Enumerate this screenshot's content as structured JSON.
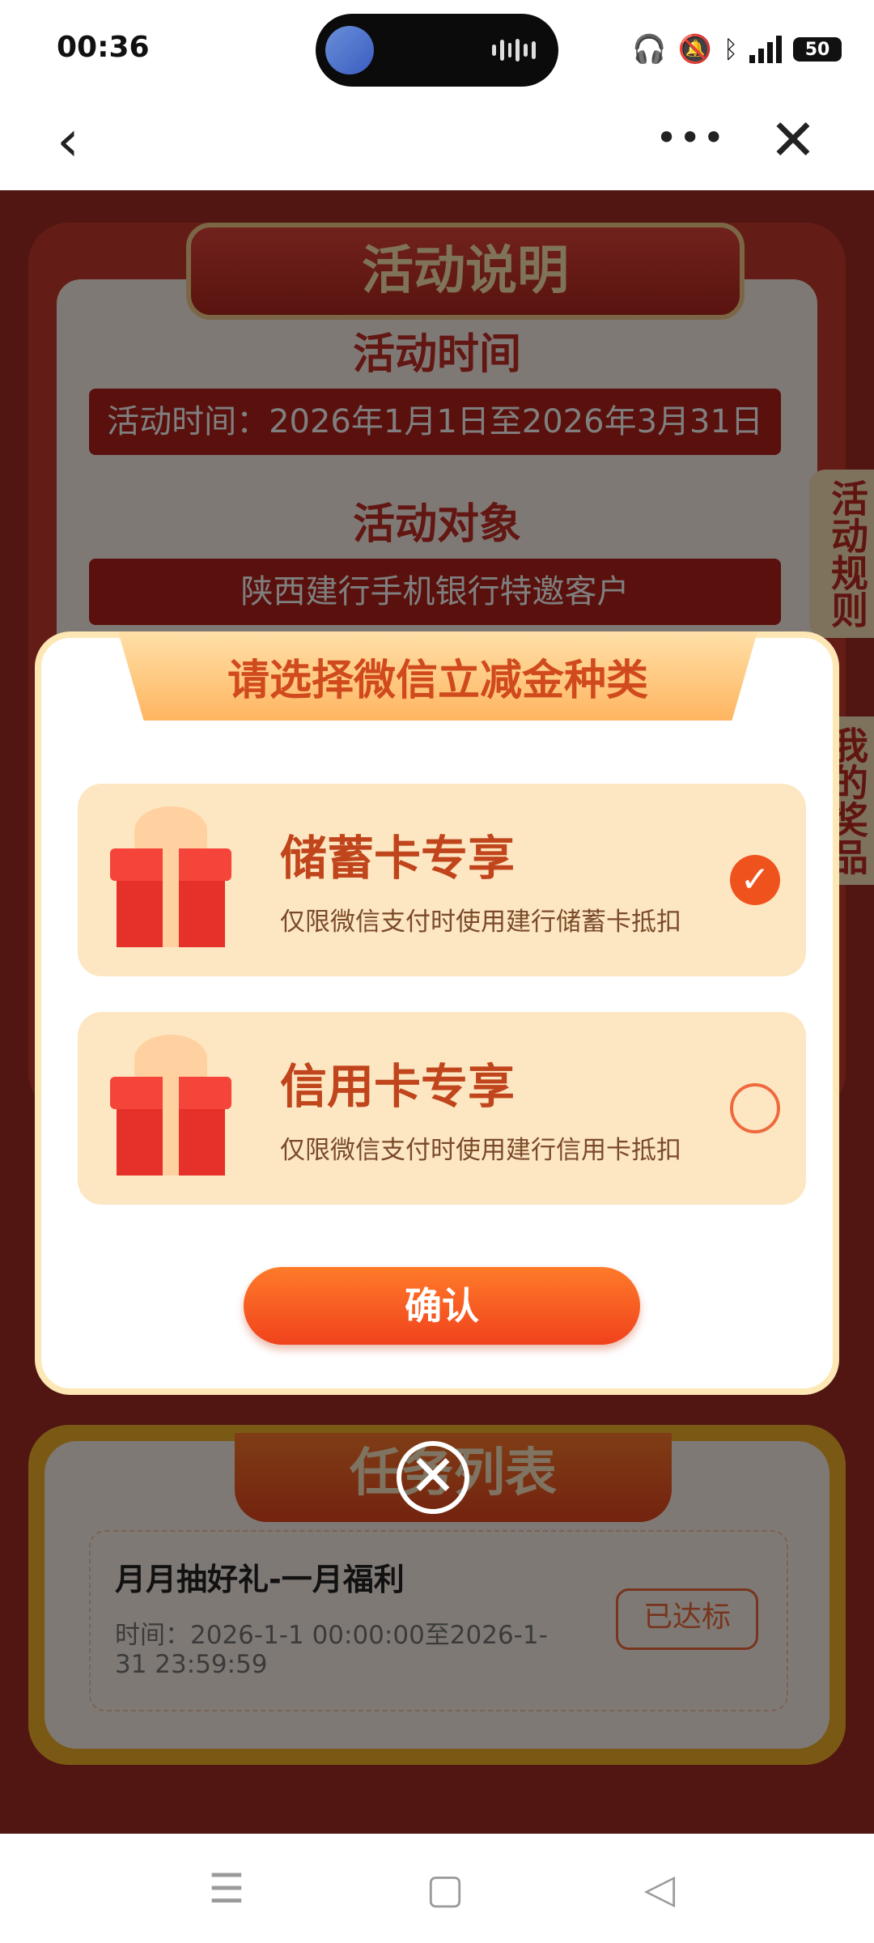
{
  "status_bar": {
    "time": "00:36",
    "battery": "50",
    "icons": [
      "headphones-icon",
      "mute-bell-icon",
      "bluetooth-icon",
      "signal-icon",
      "battery-icon"
    ]
  },
  "nav": {
    "back_icon": "chevron-left-icon",
    "more_label": "•••",
    "close_label": "✕"
  },
  "rules": {
    "banner": "活动说明",
    "time_title": "活动时间",
    "time_text": "活动时间：2026年1月1日至2026年3月31日",
    "target_title": "活动对象",
    "target_text": "陕西建行手机银行特邀客户",
    "side_tab_rules": "活动规则",
    "side_tab_prizes": "我的奖品"
  },
  "task_list": {
    "banner": "任务列表",
    "items": [
      {
        "title": "月月抽好礼-一月福利",
        "time": "时间：2026-1-1 00:00:00至2026-1-31 23:59:59",
        "status": "已达标"
      }
    ]
  },
  "modal": {
    "title": "请选择微信立减金种类",
    "options": [
      {
        "title": "储蓄卡专享",
        "desc": "仅限微信支付时使用建行储蓄卡抵扣",
        "selected": true
      },
      {
        "title": "信用卡专享",
        "desc": "仅限微信支付时使用建行信用卡抵扣",
        "selected": false
      }
    ],
    "confirm_label": "确认",
    "close_label": "✕"
  },
  "colors": {
    "page_bg": "#a32c24",
    "accent": "#f0521e",
    "option_bg": "#fde7c2"
  }
}
